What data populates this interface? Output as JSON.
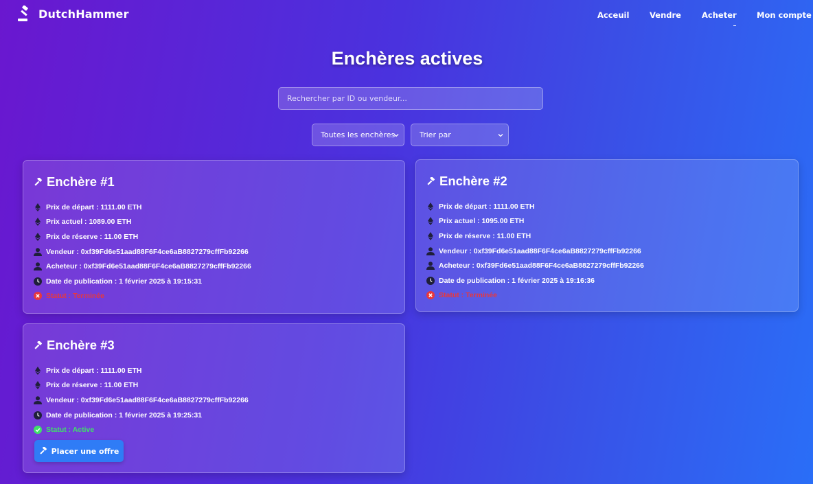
{
  "brand": {
    "name": "DutchHammer",
    "icon": "gavel-icon"
  },
  "nav": {
    "accueil": "Acceuil",
    "vendre": "Vendre",
    "acheter": "Acheter",
    "mon_compte": "Mon compte"
  },
  "page": {
    "title": "Enchères actives"
  },
  "search": {
    "placeholder": "Rechercher par ID ou vendeur..."
  },
  "filters": {
    "status_selected": "Toutes les enchères",
    "sort_selected": "Trier par"
  },
  "colors": {
    "status_ended": "#e8383c",
    "status_active": "#3fe06a",
    "button": "#2f7cf6"
  },
  "auctions": [
    {
      "title": "Enchère #1",
      "prix_depart": "Prix de départ : 1111.00 ETH",
      "prix_actuel": "Prix actuel : 1089.00 ETH",
      "prix_reserve": "Prix de réserve : 11.00 ETH",
      "vendeur": "Vendeur : 0xf39Fd6e51aad88F6F4ce6aB8827279cffFb92266",
      "acheteur": "Acheteur : 0xf39Fd6e51aad88F6F4ce6aB8827279cffFb92266",
      "date": "Date de publication : 1 février 2025 à 19:15:31",
      "statut": "Statut : Terminée"
    },
    {
      "title": "Enchère #2",
      "prix_depart": "Prix de départ : 1111.00 ETH",
      "prix_actuel": "Prix actuel : 1095.00 ETH",
      "prix_reserve": "Prix de réserve : 11.00 ETH",
      "vendeur": "Vendeur : 0xf39Fd6e51aad88F6F4ce6aB8827279cffFb92266",
      "acheteur": "Acheteur : 0xf39Fd6e51aad88F6F4ce6aB8827279cffFb92266",
      "date": "Date de publication : 1 février 2025 à 19:16:36",
      "statut": "Statut : Terminée"
    },
    {
      "title": "Enchère #3",
      "prix_depart": "Prix de départ : 1111.00 ETH",
      "prix_reserve": "Prix de réserve : 11.00 ETH",
      "vendeur": "Vendeur : 0xf39Fd6e51aad88F6F4ce6aB8827279cffFb92266",
      "date": "Date de publication : 1 février 2025 à 19:25:31",
      "statut": "Statut : Active",
      "button": "Placer une offre"
    }
  ]
}
